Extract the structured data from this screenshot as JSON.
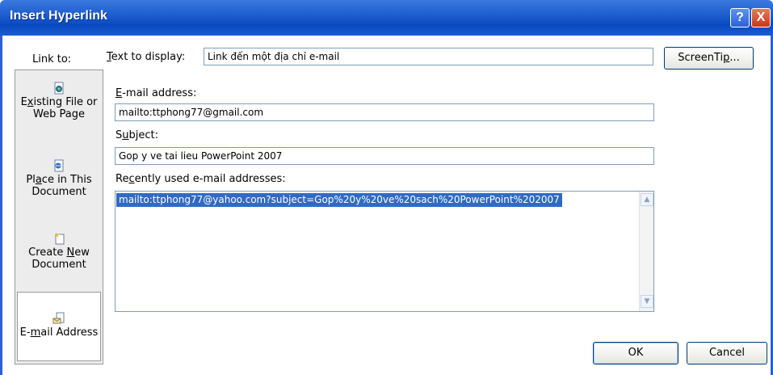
{
  "window": {
    "title": "Insert Hyperlink",
    "help_button": "?",
    "close_button": "X"
  },
  "sidebar": {
    "heading": "Link to:",
    "items": [
      {
        "line1_pre": "E",
        "line1_u": "x",
        "line1_post": "isting File or",
        "line2": "Web Page",
        "icon": "existing-file-icon"
      },
      {
        "line1_pre": "Pl",
        "line1_u": "a",
        "line1_post": "ce in This",
        "line2": "Document",
        "icon": "place-in-document-icon"
      },
      {
        "line1_pre": "Create ",
        "line1_u": "N",
        "line1_post": "ew",
        "line2": "Document",
        "icon": "new-document-icon"
      },
      {
        "line1_pre": "E-",
        "line1_u": "m",
        "line1_post": "ail Address",
        "line2": "",
        "icon": "email-address-icon",
        "selected": true
      }
    ]
  },
  "text_to_display": {
    "label_u": "T",
    "label_rest": "ext to display:",
    "value": "Link đến một địa chỉ e-mail"
  },
  "screentip_button": {
    "pre": "ScreenTi",
    "u": "p",
    "post": "..."
  },
  "email_address": {
    "label_u": "E",
    "label_rest": "-mail address:",
    "value": "mailto:ttphong77@gmail.com"
  },
  "subject": {
    "label_pre": "S",
    "label_u": "u",
    "label_rest": "bject:",
    "value": "Gop y ve tai lieu PowerPoint 2007"
  },
  "recent": {
    "label_pre": "Re",
    "label_u": "c",
    "label_rest": "ently used e-mail addresses:",
    "items": [
      "mailto:ttphong77@yahoo.com?subject=Gop%20y%20ve%20sach%20PowerPoint%202007"
    ]
  },
  "ok_button": "OK",
  "cancel_button": "Cancel",
  "colors": {
    "title_bar": "#1f5fcf",
    "selection": "#316ac5"
  }
}
